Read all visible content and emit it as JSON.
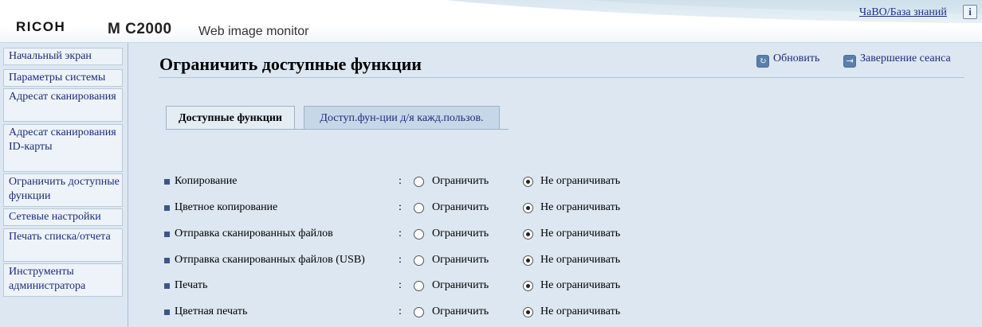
{
  "header": {
    "brand": "RICOH",
    "model": "M C2000",
    "app_name": "Web image monitor",
    "faq_link": "ЧаВО/База знаний",
    "info_icon": "info-icon"
  },
  "sidebar": {
    "items": [
      {
        "label": "Начальный экран"
      },
      {
        "label": "Параметры системы"
      },
      {
        "label": "Адресат сканирования"
      },
      {
        "label": "Адресат сканирования ID-карты"
      },
      {
        "label": "Ограничить доступные функции"
      },
      {
        "label": "Сетевые настройки"
      },
      {
        "label": "Печать списка/отчета"
      },
      {
        "label": "Инструменты администратора"
      }
    ]
  },
  "main": {
    "title": "Ограничить доступные функции",
    "actions": {
      "refresh": "Обновить",
      "logout": "Завершение сеанса"
    },
    "tabs": [
      {
        "label": "Доступные функции",
        "active": true
      },
      {
        "label": "Доступ.фун-ции д/я кажд.пользов.",
        "active": false
      }
    ],
    "option_labels": {
      "restrict": "Ограничить",
      "no_restrict": "Не ограничивать"
    },
    "separator": ":",
    "functions": [
      {
        "label": "Копирование",
        "value": "no_restrict"
      },
      {
        "label": "Цветное копирование",
        "value": "no_restrict"
      },
      {
        "label": "Отправка сканированных файлов",
        "value": "no_restrict"
      },
      {
        "label": "Отправка сканированных файлов (USB)",
        "value": "no_restrict"
      },
      {
        "label": "Печать",
        "value": "no_restrict"
      },
      {
        "label": "Цветная печать",
        "value": "no_restrict"
      }
    ]
  },
  "colors": {
    "page_bg": "#dce7f1",
    "link": "#1b2b7a",
    "bullet": "#3e5685"
  }
}
